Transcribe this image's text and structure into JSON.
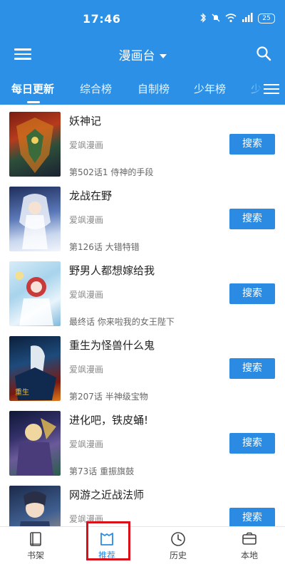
{
  "status_bar": {
    "time": "17:46",
    "battery": "25"
  },
  "header": {
    "title": "漫画台"
  },
  "tabs": [
    {
      "label": "每日更新",
      "active": true
    },
    {
      "label": "综合榜",
      "active": false
    },
    {
      "label": "自制榜",
      "active": false
    },
    {
      "label": "少年榜",
      "active": false
    },
    {
      "label": "少",
      "active": false
    }
  ],
  "items": [
    {
      "title": "妖神记",
      "source": "爱飒漫画",
      "chapter": "第502话1 侍神的手段",
      "button": "搜索"
    },
    {
      "title": "龙战在野",
      "source": "爱飒漫画",
      "chapter": "第126话 大错特错",
      "button": "搜索"
    },
    {
      "title": "野男人都想嫁给我",
      "source": "爱飒漫画",
      "chapter": "最终话 你来啦我的女王陛下",
      "button": "搜索"
    },
    {
      "title": "重生为怪兽什么鬼",
      "source": "爱飒漫画",
      "chapter": "第207话 半神级宝物",
      "button": "搜索"
    },
    {
      "title": "进化吧，铁皮蛹!",
      "source": "爱飒漫画",
      "chapter": "第73话 重振旗鼓",
      "button": "搜索"
    },
    {
      "title": "网游之近战法师",
      "source": "爱飒漫画",
      "chapter": "",
      "button": "搜索"
    }
  ],
  "bottom_nav": [
    {
      "label": "书架",
      "icon": "book-icon",
      "active": false
    },
    {
      "label": "推荐",
      "icon": "recommend-icon",
      "active": true
    },
    {
      "label": "历史",
      "icon": "clock-icon",
      "active": false
    },
    {
      "label": "本地",
      "icon": "local-icon",
      "active": false
    }
  ],
  "colors": {
    "primary": "#2b90e6",
    "button": "#2b8be3",
    "highlight": "#d9101a"
  }
}
